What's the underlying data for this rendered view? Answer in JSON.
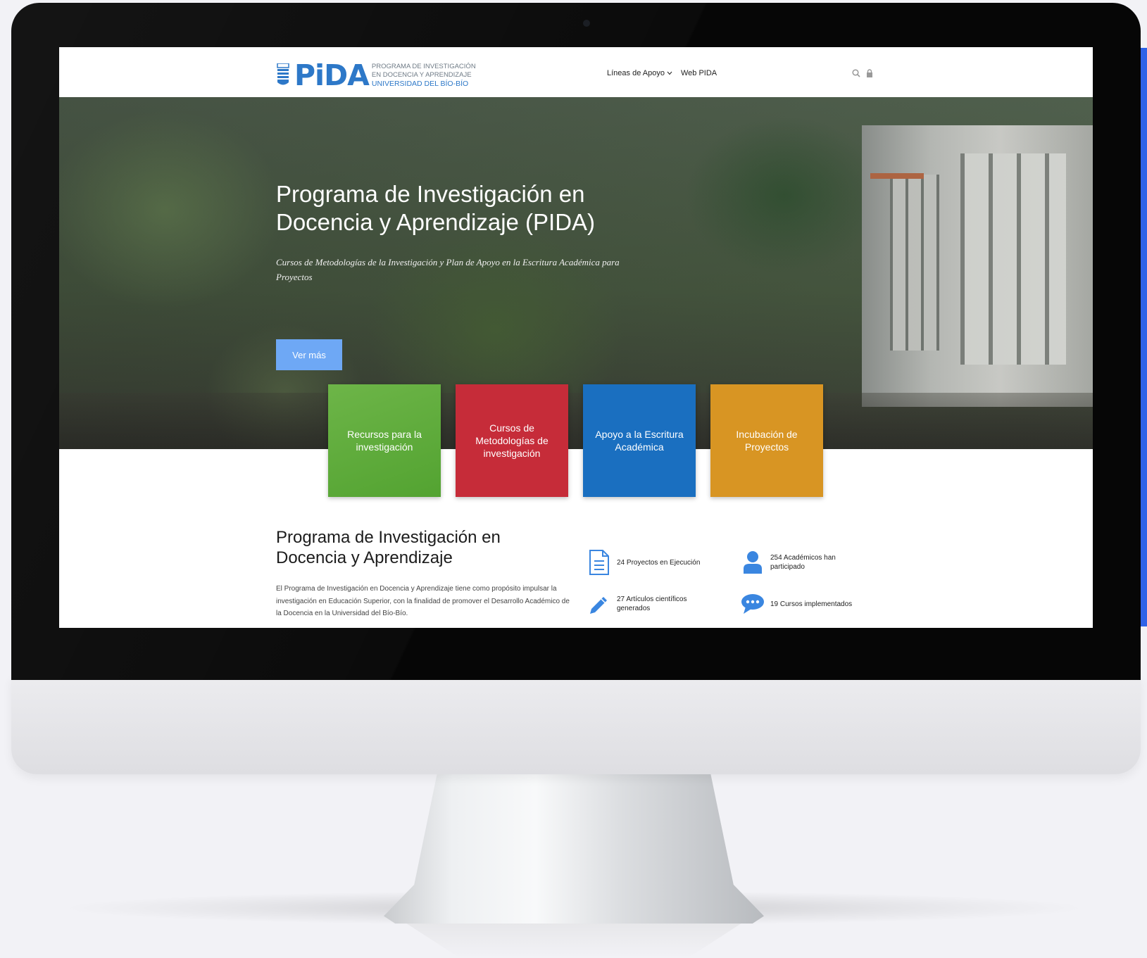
{
  "header": {
    "logo": {
      "mark": "PiDA",
      "line1": "PROGRAMA DE INVESTIGACIÓN",
      "line2": "EN DOCENCIA Y APRENDIZAJE",
      "line3": "UNIVERSIDAD DEL BÍO-BÍO"
    },
    "nav": {
      "lineas_label": "Líneas de Apoyo",
      "web_label": "Web PIDA"
    },
    "icons": [
      "search-icon",
      "lock-icon"
    ]
  },
  "hero": {
    "title": "Programa de Investigación en Docencia y Aprendizaje (PIDA)",
    "subtitle": "Cursos de Metodologías de la Investigación y Plan de Apoyo en la Escritura Académica para Proyectos",
    "button_label": "Ver más"
  },
  "cards": [
    {
      "label": "Recursos para la investigación",
      "color": "#5aa93a"
    },
    {
      "label": "Cursos de Metodologías de investigación",
      "color": "#c62c39"
    },
    {
      "label": "Apoyo a la Escritura Académica",
      "color": "#1a6fc0"
    },
    {
      "label": "Incubación de Proyectos",
      "color": "#d89523"
    }
  ],
  "intro": {
    "title": "Programa de Investigación en Docencia y Aprendizaje",
    "text": "El Programa de Investigación en Docencia y Aprendizaje tiene como propósito impulsar la investigación en Educación Superior, con la finalidad de promover el Desarrollo Académico de la Docencia en la Universidad del Bío-Bío."
  },
  "stats": [
    {
      "text": "24 Proyectos en Ejecución",
      "icon": "document-icon"
    },
    {
      "text": "254 Académicos han participado",
      "icon": "user-icon"
    },
    {
      "text": "27 Artículos científicos generados",
      "icon": "pencil-icon"
    },
    {
      "text": "19 Cursos implementados",
      "icon": "chat-bubble-icon"
    }
  ],
  "colors": {
    "brand": "#2d78c8",
    "accent": "#6ea8f5",
    "side_strip": "#2f63e8"
  }
}
